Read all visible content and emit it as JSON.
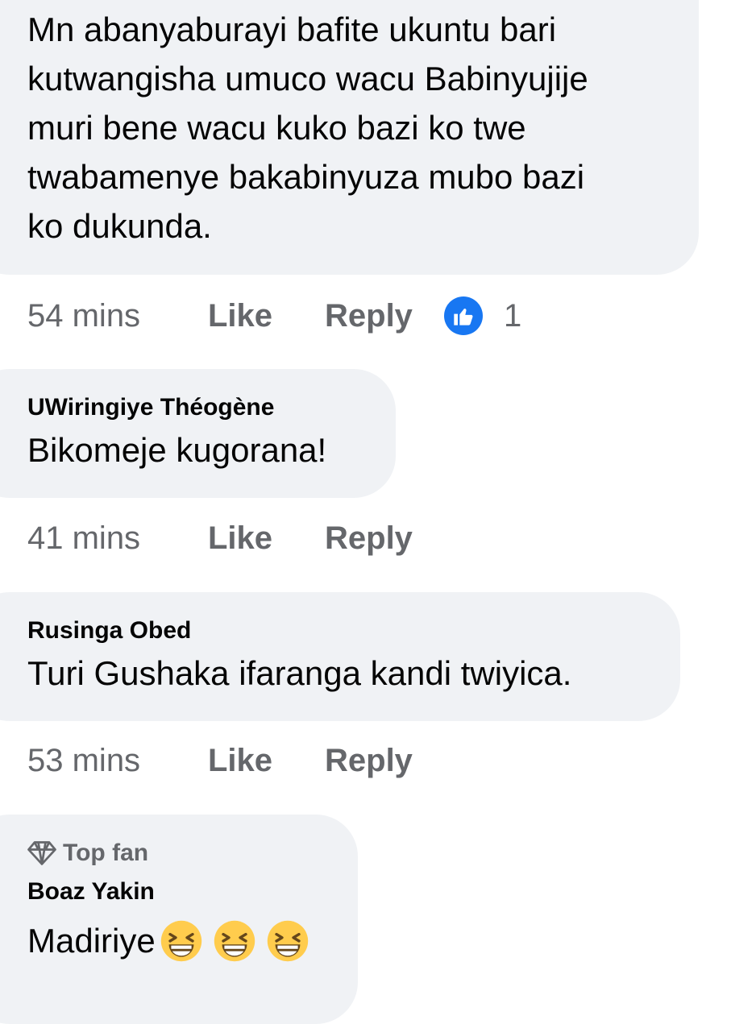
{
  "comments": [
    {
      "author": "",
      "text": "Mn abanyaburayi bafite ukuntu bari\nkutwangisha umuco wacu Babinyujije\nmuri bene wacu kuko bazi ko twe\ntwabamenye bakabinyuza mubo bazi\nko dukunda.",
      "time": "54 mins",
      "like_label": "Like",
      "reply_label": "Reply",
      "reaction_icon": "like-reaction-icon",
      "reaction_count": "1"
    },
    {
      "author": "UWiringiye Théogène",
      "text": "Bikomeje kugorana!",
      "time": "41 mins",
      "like_label": "Like",
      "reply_label": "Reply"
    },
    {
      "author": "Rusinga Obed",
      "text": "Turi Gushaka ifaranga kandi twiyica.",
      "time": "53 mins",
      "like_label": "Like",
      "reply_label": "Reply"
    },
    {
      "badge_icon": "diamond-icon",
      "badge": "Top fan",
      "author": "Boaz Yakin",
      "text": "Madiriye",
      "emojis": [
        "grinning-squinting-face",
        "grinning-squinting-face",
        "grinning-squinting-face"
      ]
    }
  ],
  "colors": {
    "bubble_bg": "#f0f2f5",
    "text": "#050505",
    "meta": "#65676b",
    "like_blue": "#1877f2"
  }
}
